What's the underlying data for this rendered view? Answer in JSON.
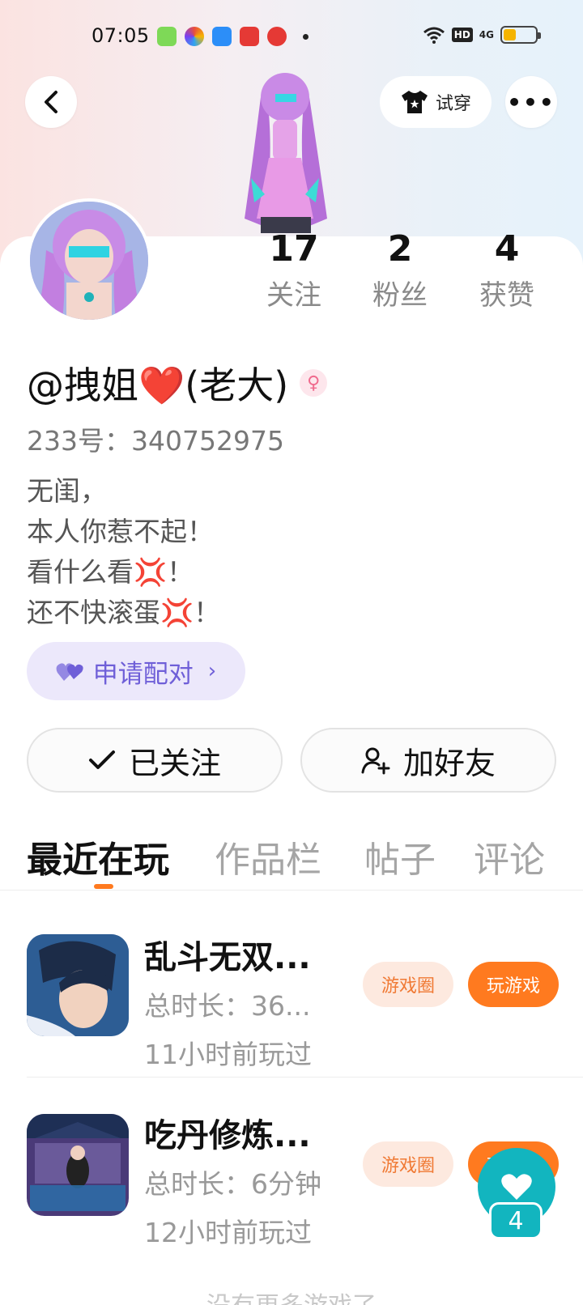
{
  "status_bar": {
    "time": "07:05",
    "network": "4G",
    "hd": "HD"
  },
  "header": {
    "tryon_label": "试穿",
    "more_label": "•••"
  },
  "profile": {
    "stats": [
      {
        "value": "17",
        "label": "关注"
      },
      {
        "value": "2",
        "label": "粉丝"
      },
      {
        "value": "4",
        "label": "获赞"
      }
    ],
    "username": "@拽姐❤️(老大)",
    "gender_symbol": "♀",
    "uid": "233号：340752975",
    "bio": [
      "无闺，",
      "本人你惹不起！",
      "看什么看💢！",
      "还不快滚蛋💢！"
    ],
    "pair_label": "申请配对",
    "follow_label": "已关注",
    "add_friend_label": "加好友"
  },
  "tabs": [
    {
      "label": "最近在玩",
      "active": true
    },
    {
      "label": "作品栏",
      "active": false
    },
    {
      "label": "帖子",
      "active": false
    },
    {
      "label": "评论",
      "active": false
    }
  ],
  "games": [
    {
      "title": "乱斗无双...",
      "duration": "总时长：36...",
      "last_played": "11小时前玩过",
      "circle_label": "游戏圈",
      "play_label": "玩游戏"
    },
    {
      "title": "吃丹修炼...",
      "duration": "总时长：6分钟",
      "last_played": "12小时前玩过",
      "circle_label": "游戏圈",
      "play_label": "玩游戏"
    }
  ],
  "like_fab": {
    "count": "4"
  },
  "footer_hint": "没有更多游戏了"
}
